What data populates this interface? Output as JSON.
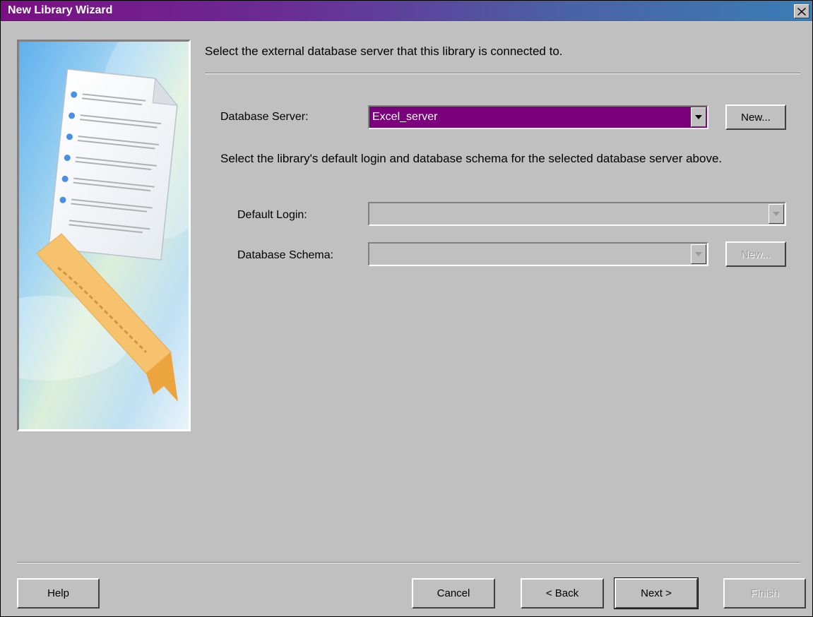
{
  "window": {
    "title": "New Library Wizard"
  },
  "main": {
    "heading": "Select the external database server that this library is connected to.",
    "database_server": {
      "label": "Database Server:",
      "value": "Excel_server",
      "new_label": "New..."
    },
    "instructions": "Select the library's default login and database schema for the selected database server above.",
    "default_login": {
      "label": "Default Login:",
      "value": ""
    },
    "database_schema": {
      "label": "Database Schema:",
      "value": "",
      "new_label": "New..."
    }
  },
  "footer": {
    "help": "Help",
    "cancel": "Cancel",
    "back": "< Back",
    "next": "Next >",
    "finish": "Finish"
  },
  "colors": {
    "title_start": "#7a0f83",
    "title_end": "#3a7db6",
    "selection": "#7b007b",
    "face": "#c0c0c0"
  },
  "icons": [
    "close-icon",
    "wizard-document-illustration",
    "dropdown-arrow-icon"
  ]
}
